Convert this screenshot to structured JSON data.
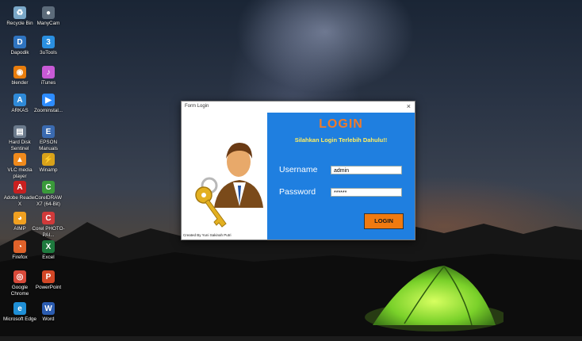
{
  "desktop": {
    "icons": [
      {
        "label": "Recycle Bin",
        "icon": "recycle-bin-icon",
        "color": "#7aa7c7",
        "glyph": "♻"
      },
      {
        "label": "ManyCam",
        "icon": "manycam-icon",
        "color": "#5c6b7a",
        "glyph": "●"
      },
      {
        "label": "Dapodik",
        "icon": "dapodik-icon",
        "color": "#2f74c0",
        "glyph": "D"
      },
      {
        "label": "3uTools",
        "icon": "3utools-icon",
        "color": "#2a8fe0",
        "glyph": "3"
      },
      {
        "label": "blender",
        "icon": "blender-icon",
        "color": "#e87d0d",
        "glyph": "◉"
      },
      {
        "label": "iTunes",
        "icon": "itunes-icon",
        "color": "#c85ad6",
        "glyph": "♪"
      },
      {
        "label": "ARKAS",
        "icon": "arkas-icon",
        "color": "#2f8ad8",
        "glyph": "A"
      },
      {
        "label": "Zoominstal...",
        "icon": "zoom-icon",
        "color": "#2d8cff",
        "glyph": "▶"
      },
      {
        "label": "Hard Disk Sentinel",
        "icon": "hard-disk-sentinel-icon",
        "color": "#6b7a8c",
        "glyph": "▤"
      },
      {
        "label": "EPSON Manuals",
        "icon": "epson-manuals-icon",
        "color": "#3a6ab0",
        "glyph": "E"
      },
      {
        "label": "VLC media player",
        "icon": "vlc-icon",
        "color": "#f08a1c",
        "glyph": "▲"
      },
      {
        "label": "Winamp",
        "icon": "winamp-icon",
        "color": "#d9a21a",
        "glyph": "⚡"
      },
      {
        "label": "Adobe Reader X",
        "icon": "adobe-reader-icon",
        "color": "#c82020",
        "glyph": "A"
      },
      {
        "label": "CorelDRAW X7 (64-Bit)",
        "icon": "coreldraw-icon",
        "color": "#3a9a3a",
        "glyph": "C"
      },
      {
        "label": "AIMP",
        "icon": "aimp-icon",
        "color": "#f0a020",
        "glyph": "◕"
      },
      {
        "label": "Corel PHOTO-PAI...",
        "icon": "corel-photo-paint-icon",
        "color": "#d03a3a",
        "glyph": "C"
      },
      {
        "label": "Firefox",
        "icon": "firefox-icon",
        "color": "#e0622a",
        "glyph": "◔"
      },
      {
        "label": "Excel",
        "icon": "excel-icon",
        "color": "#1e7a3e",
        "glyph": "X"
      },
      {
        "label": "Google Chrome",
        "icon": "chrome-icon",
        "color": "#d94a3a",
        "glyph": "◎"
      },
      {
        "label": "PowerPoint",
        "icon": "powerpoint-icon",
        "color": "#d24726",
        "glyph": "P"
      },
      {
        "label": "Microsoft Edge",
        "icon": "edge-icon",
        "color": "#1f8fd6",
        "glyph": "e"
      },
      {
        "label": "Word",
        "icon": "word-icon",
        "color": "#2b5cb0",
        "glyph": "W"
      }
    ]
  },
  "window": {
    "title": "Form Login",
    "close_glyph": "×",
    "created_by": "Created By Yuni Sakinah Putri",
    "heading": "LOGIN",
    "subtitle": "Silahkan Login Terlebih Dahulu!!",
    "username_label": "Username",
    "username_value": "admin",
    "password_label": "Password",
    "password_value": "******",
    "login_button": "LOGIN"
  },
  "colors": {
    "blue_panel": "#1f7fe0",
    "heading": "#f07a2a",
    "subtitle": "#ffef60",
    "button": "#f07a10"
  }
}
